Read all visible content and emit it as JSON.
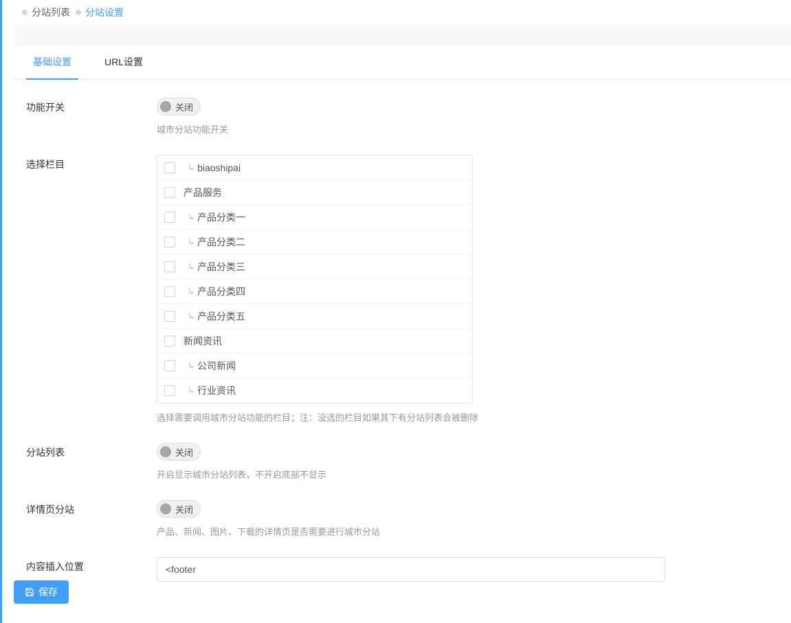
{
  "breadcrumb": {
    "items": [
      {
        "label": "分站列表",
        "active": false
      },
      {
        "label": "分站设置",
        "active": true
      }
    ]
  },
  "tabs": [
    {
      "label": "基础设置",
      "active": true
    },
    {
      "label": "URL设置",
      "active": false
    }
  ],
  "form": {
    "feature_switch": {
      "label": "功能开关",
      "state": "关闭",
      "help": "城市分站功能开关"
    },
    "select_columns": {
      "label": "选择栏目",
      "help": "选择需要调用城市分站功能的栏目；注：没选的栏目如果其下有分站列表会被删除",
      "items": [
        {
          "label": "biaoshipai",
          "indent": 1
        },
        {
          "label": "产品服务",
          "indent": 0
        },
        {
          "label": "产品分类一",
          "indent": 1
        },
        {
          "label": "产品分类二",
          "indent": 1
        },
        {
          "label": "产品分类三",
          "indent": 1
        },
        {
          "label": "产品分类四",
          "indent": 1
        },
        {
          "label": "产品分类五",
          "indent": 1
        },
        {
          "label": "新闻资讯",
          "indent": 0
        },
        {
          "label": "公司新闻",
          "indent": 1
        },
        {
          "label": "行业资讯",
          "indent": 1
        }
      ]
    },
    "site_list_switch": {
      "label": "分站列表",
      "state": "关闭",
      "help": "开启显示城市分站列表，不开启底部不显示"
    },
    "detail_switch": {
      "label": "详情页分站",
      "state": "关闭",
      "help": "产品、新闻、图片、下载的详情页是否需要进行城市分站"
    },
    "insert_position": {
      "label": "内容插入位置",
      "value": "<footer"
    }
  },
  "footer": {
    "save_label": "保存"
  }
}
